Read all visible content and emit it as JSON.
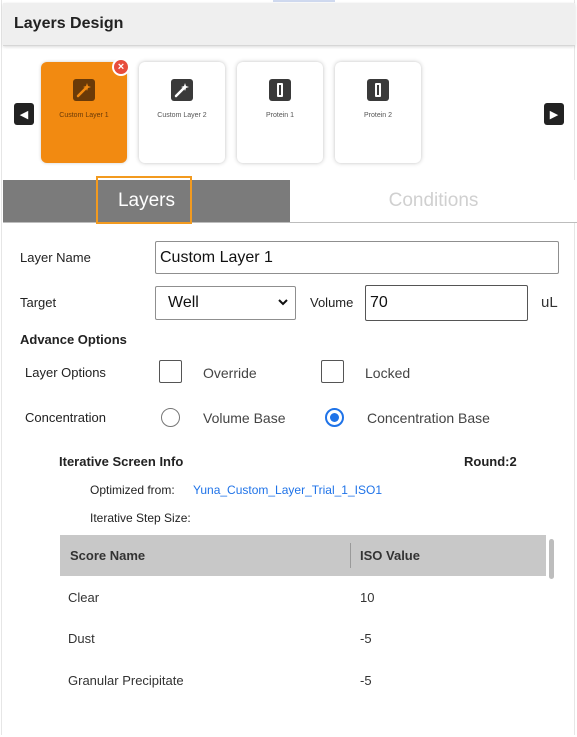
{
  "header": {
    "title": "Layers Design"
  },
  "carousel": {
    "prev_icon": "◀",
    "next_icon": "▶",
    "close_icon": "×",
    "cards": [
      {
        "label": "Custom Layer 1",
        "icon": "wand-icon",
        "active": true
      },
      {
        "label": "Custom Layer 2",
        "icon": "wand-icon",
        "active": false
      },
      {
        "label": "Protein 1",
        "icon": "tube-icon",
        "active": false
      },
      {
        "label": "Protein 2",
        "icon": "tube-icon",
        "active": false
      }
    ]
  },
  "tabs": {
    "layers": "Layers",
    "conditions": "Conditions"
  },
  "form": {
    "layer_name_label": "Layer Name",
    "layer_name_value": "Custom Layer 1",
    "target_label": "Target",
    "target_value": "Well",
    "volume_label": "Volume",
    "volume_value": "70",
    "volume_unit": "uL",
    "advance_options_label": "Advance Options",
    "layer_options_label": "Layer Options",
    "override_label": "Override",
    "locked_label": "Locked",
    "concentration_label": "Concentration",
    "volume_base_label": "Volume Base",
    "concentration_base_label": "Concentration Base",
    "selected_concentration": "Concentration Base"
  },
  "iterative": {
    "title": "Iterative Screen Info",
    "round": "Round:2",
    "optimized_from_label": "Optimized from:",
    "optimized_from_link": "Yuna_Custom_Layer_Trial_1_ISO1",
    "step_size_label": "Iterative Step Size:"
  },
  "table": {
    "headers": [
      "Score Name",
      "ISO Value"
    ],
    "rows": [
      [
        "Clear",
        "10"
      ],
      [
        "Dust",
        "-5"
      ],
      [
        "Granular Precipitate",
        "-5"
      ]
    ]
  },
  "colors": {
    "accent": "#f28a11",
    "link": "#1f73e8",
    "tab_active": "#7b7b7b"
  }
}
